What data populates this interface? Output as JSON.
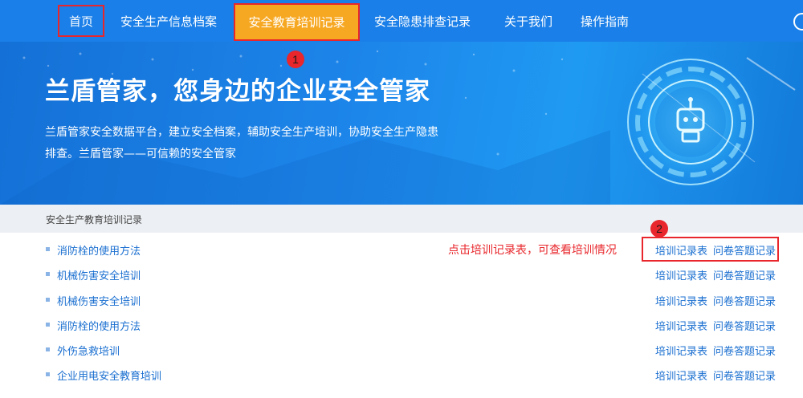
{
  "nav": {
    "items": [
      {
        "label": "首页"
      },
      {
        "label": "安全生产信息档案"
      },
      {
        "label": "安全教育培训记录"
      },
      {
        "label": "安全隐患排查记录"
      },
      {
        "label": "关于我们"
      },
      {
        "label": "操作指南"
      }
    ],
    "user_icon": "user-icon",
    "active_color": "#f7a823",
    "bar_color": "#1a7fe8"
  },
  "annotations": {
    "callout_1": "1",
    "callout_2": "2",
    "hint": "点击培训记录表，可查看培训情况",
    "highlight_color": "#e8262b"
  },
  "banner": {
    "title": "兰盾管家，您身边的企业安全管家",
    "description": "兰盾管家安全数据平台，建立安全档案，辅助安全生产培训，协助安全生产隐患排查。兰盾管家——可信赖的安全管家",
    "art_icon": "robot-icon"
  },
  "section": {
    "title": "安全生产教育培训记录"
  },
  "records": [
    {
      "title": "消防栓的使用方法",
      "record_link": "培训记录表",
      "quiz_link": "问卷答题记录"
    },
    {
      "title": "机械伤害安全培训",
      "record_link": "培训记录表",
      "quiz_link": "问卷答题记录"
    },
    {
      "title": "机械伤害安全培训",
      "record_link": "培训记录表",
      "quiz_link": "问卷答题记录"
    },
    {
      "title": "消防栓的使用方法",
      "record_link": "培训记录表",
      "quiz_link": "问卷答题记录"
    },
    {
      "title": "外伤急救培训",
      "record_link": "培训记录表",
      "quiz_link": "问卷答题记录"
    },
    {
      "title": "企业用电安全教育培训",
      "record_link": "培训记录表",
      "quiz_link": "问卷答题记录"
    }
  ]
}
